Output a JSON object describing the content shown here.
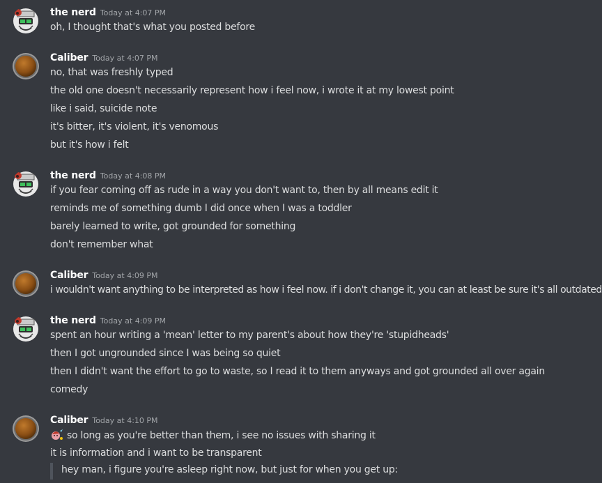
{
  "messages": [
    {
      "author": "the nerd",
      "timestamp": "Today at 4:07 PM",
      "avatar_icon": "nerd-avatar",
      "lines": [
        "oh, I thought that's what you posted before"
      ]
    },
    {
      "author": "Caliber",
      "timestamp": "Today at 4:07 PM",
      "avatar_icon": "bronze-orb-avatar",
      "lines": [
        "no, that was freshly typed",
        "the old one doesn't necessarily represent how i feel now, i wrote it at my lowest point",
        "like i said, suicide note",
        "it's bitter, it's violent, it's venomous",
        "but it's how i felt"
      ]
    },
    {
      "author": "the nerd",
      "timestamp": "Today at 4:08 PM",
      "avatar_icon": "nerd-avatar",
      "lines": [
        "if you fear coming off as rude in a way you don't want to, then by all means edit it",
        "reminds me of something dumb I did once when I was a toddler",
        "barely learned to write, got grounded for something",
        "don't remember what"
      ]
    },
    {
      "author": "Caliber",
      "timestamp": "Today at 4:09 PM",
      "avatar_icon": "bronze-orb-avatar",
      "lines": [
        "i wouldn't want anything to be interpreted as how i feel now.  if i don't change it, you can at least be sure it's all outdated."
      ]
    },
    {
      "author": "the nerd",
      "timestamp": "Today at 4:09 PM",
      "avatar_icon": "nerd-avatar",
      "lines": [
        "spent an hour writing a 'mean' letter to my parent's about how they're 'stupidheads'",
        "then I got ungrounded since I was being so quiet",
        "then I didn't want the effort to go to waste, so I read it to them anyways and got grounded all over again",
        "comedy"
      ]
    },
    {
      "author": "Caliber",
      "timestamp": "Today at 4:10 PM",
      "avatar_icon": "bronze-orb-avatar",
      "emoji_icon": "custom-emoji-icon",
      "lines": [
        "so long as you're better than them, i see no issues with sharing it",
        "it is information and i want to be transparent"
      ],
      "quote": "hey man, i figure you're asleep right now, but just for when you get up:"
    }
  ],
  "colors": {
    "background": "#36393f",
    "text": "#dcddde",
    "username": "#ffffff",
    "timestamp": "#a3a6aa",
    "quote_bar": "#4f545c"
  }
}
